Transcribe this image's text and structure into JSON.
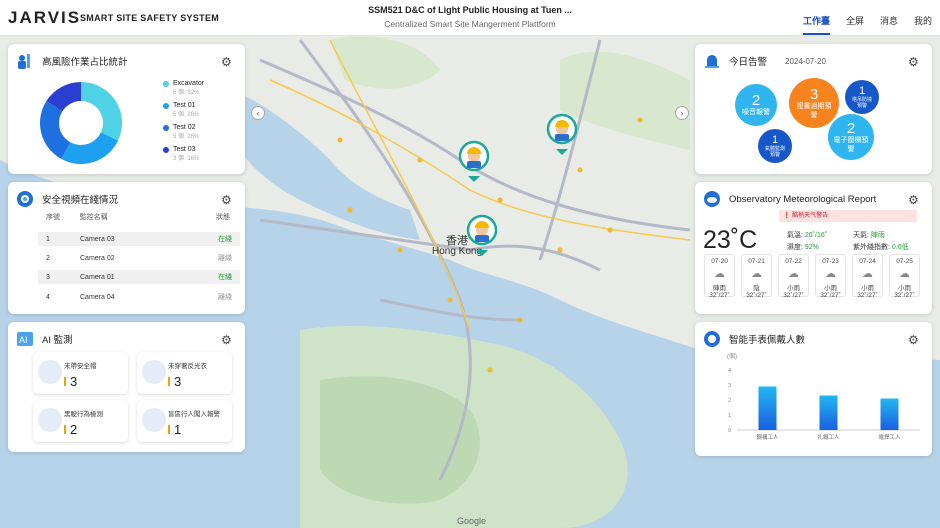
{
  "header": {
    "logo": "JARVIS",
    "system_name": "SMART SITE SAFETY SYSTEM",
    "project_title": "SSM521 D&C of Light Public Housing at Tuen ...",
    "platform_subtitle": "Centralized Smart Site Mangerment Plattform",
    "nav": [
      "工作臺",
      "全屏",
      "消息",
      "我的"
    ]
  },
  "high_risk": {
    "title": "高風險作業占比統計",
    "legend": [
      {
        "name": "Excavator",
        "count": "6 個",
        "pct": "32%",
        "color": "#4fd1e6"
      },
      {
        "name": "Test 01",
        "count": "5 個",
        "pct": "26%",
        "color": "#1ea0f0"
      },
      {
        "name": "Test 02",
        "count": "5 個",
        "pct": "26%",
        "color": "#1e6fe0"
      },
      {
        "name": "Test 03",
        "count": "3 個",
        "pct": "16%",
        "color": "#2a3fd0"
      }
    ],
    "values": [
      32,
      26,
      26,
      16
    ]
  },
  "video": {
    "title": "安全視頻在綫情況",
    "headers": [
      "序號",
      "監控名稱",
      "狀態"
    ],
    "rows": [
      [
        "1",
        "Camera 03",
        "在綫"
      ],
      [
        "2",
        "Camera 02",
        "離綫"
      ],
      [
        "3",
        "Camera 01",
        "在綫"
      ],
      [
        "4",
        "Camera 04",
        "離綫"
      ]
    ]
  },
  "ai": {
    "title": "AI 監測",
    "cards": [
      {
        "label": "未帶安全帽",
        "value": "3"
      },
      {
        "label": "未穿著反光衣",
        "value": "3"
      },
      {
        "label": "黑駛行為檢測",
        "value": "2"
      },
      {
        "label": "盲區行人闖入報警",
        "value": "1"
      }
    ]
  },
  "alerts": {
    "title": "今日告警",
    "date": "2024-07-20",
    "bubbles": [
      {
        "num": "2",
        "label": "噪音報警"
      },
      {
        "num": "3",
        "label": "證書過期預警"
      },
      {
        "num": "1",
        "label": "塔吊防撞預警"
      },
      {
        "num": "1",
        "label": "氣體監測預警"
      },
      {
        "num": "2",
        "label": "電子圍欄預警"
      }
    ]
  },
  "weather": {
    "title": "Observatory Meteorological Report",
    "alert": "酷熱天气警告",
    "temp": "23˚C",
    "temp_range_label": "氣溫",
    "temp_range": "26˚/16˚",
    "weather_label": "天氣",
    "weather": "陣雨",
    "humidity_label": "濕度",
    "humidity": "92%",
    "uv_label": "紫外綫指數",
    "uv": "0.6低",
    "forecast": [
      {
        "date": "07-20",
        "desc": "陣雨",
        "range": "32˚/27˚"
      },
      {
        "date": "07-21",
        "desc": "陰",
        "range": "32˚/27˚"
      },
      {
        "date": "07-22",
        "desc": "小雨",
        "range": "32˚/27˚"
      },
      {
        "date": "07-23",
        "desc": "小雨",
        "range": "32˚/27˚"
      },
      {
        "date": "07-24",
        "desc": "小雨",
        "range": "32˚/27˚"
      },
      {
        "date": "07-25",
        "desc": "小雨",
        "range": "32˚/27˚"
      }
    ]
  },
  "wearables": {
    "title": "智能手表佩戴人數",
    "unit": "(個)",
    "chart_data": {
      "type": "bar",
      "categories": [
        "鋼構工人",
        "扎鐵工人",
        "電焊工人"
      ],
      "values": [
        2.9,
        2.3,
        2.1
      ],
      "ylim": [
        0,
        4
      ],
      "yticks": [
        "0",
        "1",
        "2",
        "3",
        "4"
      ]
    }
  },
  "map": {
    "label_cn": "香港",
    "label_en": "Hong Kong",
    "google": "Google"
  }
}
